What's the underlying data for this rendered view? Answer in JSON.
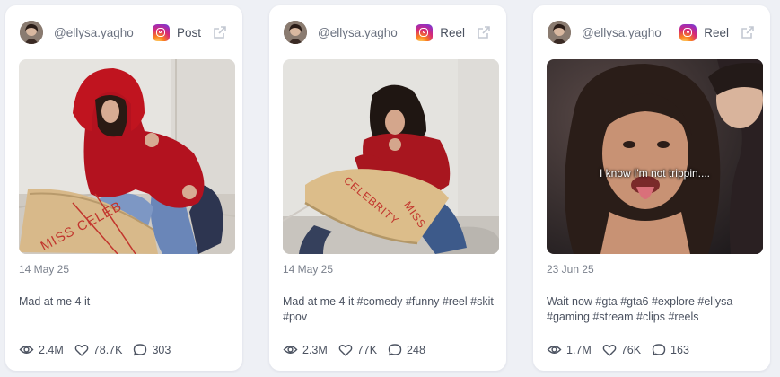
{
  "cards": [
    {
      "handle": "@ellysa.yagho",
      "post_type": "Post",
      "date": "14 May 25",
      "caption": "Mad at me 4 it",
      "views": "2.4M",
      "likes": "78.7K",
      "comments": "303",
      "image_text": ""
    },
    {
      "handle": "@ellysa.yagho",
      "post_type": "Reel",
      "date": "14 May 25",
      "caption": "Mad at me 4 it #comedy #funny #reel #skit #pov",
      "views": "2.3M",
      "likes": "77K",
      "comments": "248",
      "image_text": ""
    },
    {
      "handle": "@ellysa.yagho",
      "post_type": "Reel",
      "date": "23 Jun 25",
      "caption": "Wait now #gta #gta6 #explore #ellysa #gaming #stream #clips #reels",
      "views": "1.7M",
      "likes": "76K",
      "comments": "163",
      "image_text": "I know I'm not trippin...."
    }
  ],
  "desk_writing": "MISS CELEBRITY",
  "icons": {
    "platform": "instagram-icon",
    "open": "external-link-icon",
    "views": "eye-icon",
    "likes": "heart-icon",
    "comments": "comment-icon"
  },
  "colors": {
    "background": "#eef0f5",
    "card": "#ffffff",
    "text": "#4b5260",
    "muted": "#7a808c"
  }
}
